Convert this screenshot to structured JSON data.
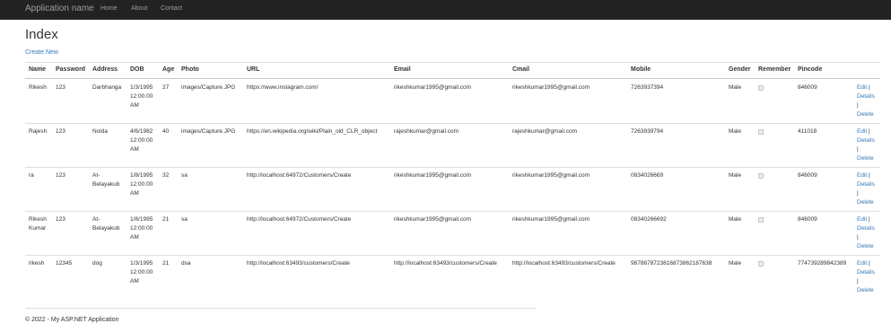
{
  "nav": {
    "brand": "Application name",
    "links": [
      "Home",
      "About",
      "Contact"
    ]
  },
  "page": {
    "title": "Index",
    "create_link": "Create New"
  },
  "table": {
    "headers": [
      "Name",
      "Password",
      "Address",
      "DOB",
      "Age",
      "Photo",
      "URL",
      "Email",
      "Cmail",
      "Mobile",
      "Gender",
      "Remember",
      "Pincode"
    ],
    "rows": [
      {
        "name": "Rikesh",
        "password": "123",
        "address": "Darbhanga",
        "dob": [
          "1/3/1995",
          "12:00:00",
          "AM"
        ],
        "age": "27",
        "photo": "images/Capture.JPG",
        "url": "https://www.instagram.com/",
        "email": "rikeshkumar1995@gmail.com",
        "cmail": "rikeshkumar1995@gmail.com",
        "mobile": "7263937394",
        "gender": "Male",
        "remember": false,
        "pincode": "846009"
      },
      {
        "name": "Rajesh",
        "password": "123",
        "address": "Noida",
        "dob": [
          "4/6/1982",
          "12:00:00",
          "AM"
        ],
        "age": "40",
        "photo": "images/Capture.JPG",
        "url": "https://en.wikipedia.org/wiki/Plain_old_CLR_object",
        "email": "rajeshkumar@gmail.com",
        "cmail": "rajeshkumar@gmail.com",
        "mobile": "7263939794",
        "gender": "Male",
        "remember": false,
        "pincode": "411018"
      },
      {
        "name": "ra",
        "password": "123",
        "address": [
          "At-",
          "Belayakub"
        ],
        "dob": [
          "1/8/1995",
          "12:00:00",
          "AM"
        ],
        "age": "32",
        "photo": "sa",
        "url": "http://localhost:64972/Customers/Create",
        "email": "rikeshkumar1995@gmail.com",
        "cmail": "rikeshkumar1995@gmail.com",
        "mobile": "0834026669",
        "gender": "Male",
        "remember": false,
        "pincode": "846009"
      },
      {
        "name": [
          "Rikesh",
          "Kumar"
        ],
        "password": "123",
        "address": [
          "At-",
          "Belayakub"
        ],
        "dob": [
          "1/8/1995",
          "12:00:00",
          "AM"
        ],
        "age": "21",
        "photo": "sa",
        "url": "http://localhost:64972/Customers/Create",
        "email": "rikeshkumar1995@gmail.com",
        "cmail": "rikeshkumar1995@gmail.com",
        "mobile": "08340266692",
        "gender": "Male",
        "remember": false,
        "pincode": "846009"
      },
      {
        "name": "rikesh",
        "password": "12345",
        "address": "dog",
        "dob": [
          "1/3/1995",
          "12:00:00",
          "AM"
        ],
        "age": "21",
        "photo": "dsa",
        "url": "http://localhost:63493/customers/Create",
        "email": "http://localhost:63493/customers/Create",
        "cmail": "http://localhost:63493/customers/Create",
        "mobile": "9878878723816873862187638",
        "gender": "Male",
        "remember": false,
        "pincode": "774739289842389"
      }
    ],
    "actions": {
      "edit": "Edit",
      "sep": "|",
      "details": "Details",
      "delete": "Delete"
    }
  },
  "footer": {
    "text": "© 2022 - My ASP.NET Application"
  },
  "colors": {
    "navbar_bg": "#222222",
    "nav_text": "#9d9d9d",
    "link": "#337ab7",
    "text": "#333333",
    "border": "#dddddd"
  }
}
